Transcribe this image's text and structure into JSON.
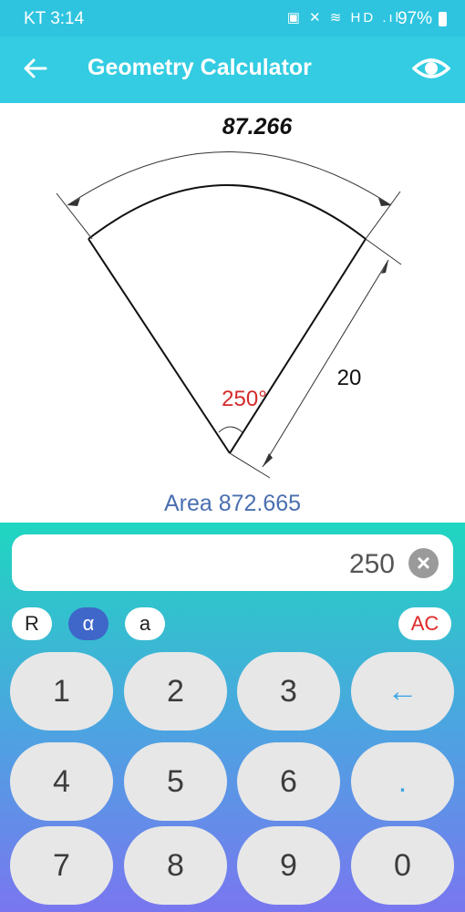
{
  "status": {
    "time": "KT 3:14",
    "battery": "97%",
    "icons": "▣ ✕ ≋ HD .ıl"
  },
  "appbar": {
    "title": "Geometry Calculator",
    "back_icon": "arrow-left-icon",
    "eye_icon": "eye-icon"
  },
  "figure": {
    "arc_length": "87.266",
    "radius_label": "20",
    "angle_label": "250°"
  },
  "area": {
    "label": "Area 872.665"
  },
  "input": {
    "value": "250",
    "clear_icon": "×"
  },
  "modes": {
    "r": "R",
    "alpha": "α",
    "a": "a",
    "ac": "AC"
  },
  "keys": {
    "k1": "1",
    "k2": "2",
    "k3": "3",
    "back": "←",
    "k4": "4",
    "k5": "5",
    "k6": "6",
    "dot": ".",
    "k7": "7",
    "k8": "8",
    "k9": "9",
    "k0": "0"
  },
  "colors": {
    "appbar": "#33cce2",
    "angle": "#d42a2a",
    "area": "#4a6fb0",
    "active_mode": "#3f66c9"
  }
}
